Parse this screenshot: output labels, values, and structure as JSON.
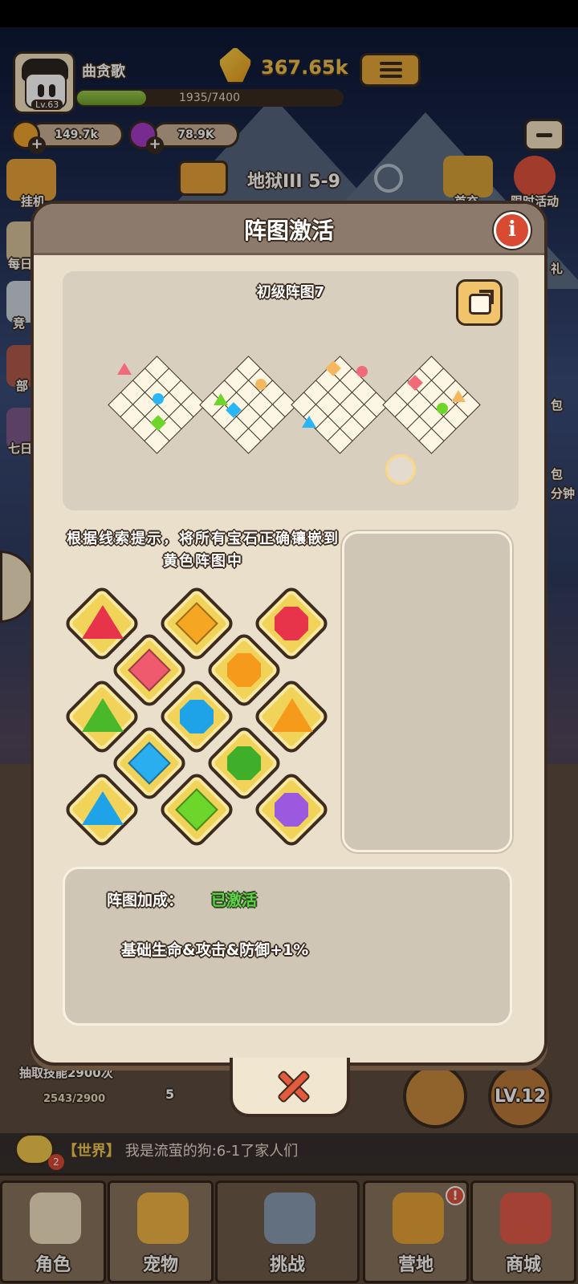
{
  "hud": {
    "player_name": "曲贪歌",
    "level": "Lv.63",
    "xp_text": "1935/7400",
    "xp_fraction": 0.26,
    "power": "367.65k",
    "gold": "149.7k",
    "gems": "78.9K",
    "stage": "地狱III 5-9",
    "side_left": [
      "挂机",
      "每日",
      "竞",
      "部",
      "七日"
    ],
    "side_right": [
      "首充",
      "限时活动",
      "礼",
      "包",
      "包",
      "分钟"
    ]
  },
  "modal": {
    "title": "阵图激活",
    "pattern_title": "初级阵图7",
    "hint": "根据线索提示，将所有宝石正确镶嵌到黄色阵图中",
    "bonus_label": "阵图加成：",
    "bonus_status": "已激活",
    "bonus_desc": "基础生命&攻击&防御+1%"
  },
  "gems": [
    {
      "shape": "triangle",
      "color": "#e8344a"
    },
    {
      "shape": "diamond",
      "color": "#f5a623"
    },
    {
      "shape": "octagon",
      "color": "#e8344a"
    },
    {
      "shape": "diamond",
      "color": "#ef5a6f"
    },
    {
      "shape": "octagon",
      "color": "#f59a1a"
    },
    {
      "shape": "triangle",
      "color": "#49b82a"
    },
    {
      "shape": "octagon",
      "color": "#1ea3e8"
    },
    {
      "shape": "triangle",
      "color": "#f59a1a"
    },
    {
      "shape": "diamond",
      "color": "#2aaef0"
    },
    {
      "shape": "octagon",
      "color": "#3fae2a"
    },
    {
      "shape": "triangle",
      "color": "#1ea3e8"
    },
    {
      "shape": "diamond",
      "color": "#6dd62a"
    },
    {
      "shape": "octagon",
      "color": "#9b59e0"
    }
  ],
  "clue_marks": [
    [
      {
        "shape": "triangle",
        "color": "#ef6b7a"
      },
      {
        "shape": "circle",
        "color": "#29b6f6"
      },
      {
        "shape": "diamond",
        "color": "#6dd62a"
      }
    ],
    [
      {
        "shape": "circle",
        "color": "#f5b860"
      },
      {
        "shape": "triangle",
        "color": "#6dd62a"
      },
      {
        "shape": "diamond",
        "color": "#29b6f6"
      }
    ],
    [
      {
        "shape": "diamond",
        "color": "#f5b860"
      },
      {
        "shape": "circle",
        "color": "#ef6b7a"
      },
      {
        "shape": "triangle",
        "color": "#29b6f6"
      }
    ],
    [
      {
        "shape": "diamond",
        "color": "#ef6b7a"
      },
      {
        "shape": "triangle",
        "color": "#f5b860"
      },
      {
        "shape": "circle",
        "color": "#6dd62a"
      }
    ]
  ],
  "behind": {
    "skill_text": "抽取技能2900次",
    "skill_progress": "2543/2900",
    "count": "5",
    "level_button": "LV.12",
    "chat_channel": "【世界】",
    "chat_message": "我是流萤的狗:6-1了家人们",
    "chat_unread": "2"
  },
  "nav": [
    {
      "label": "角色",
      "color": "#f3e2c3"
    },
    {
      "label": "宠物",
      "color": "#f2b544"
    },
    {
      "label": "挑战",
      "color": "#8a9bb0"
    },
    {
      "label": "营地",
      "color": "#e8a236"
    },
    {
      "label": "商城",
      "color": "#e35a4a"
    }
  ]
}
